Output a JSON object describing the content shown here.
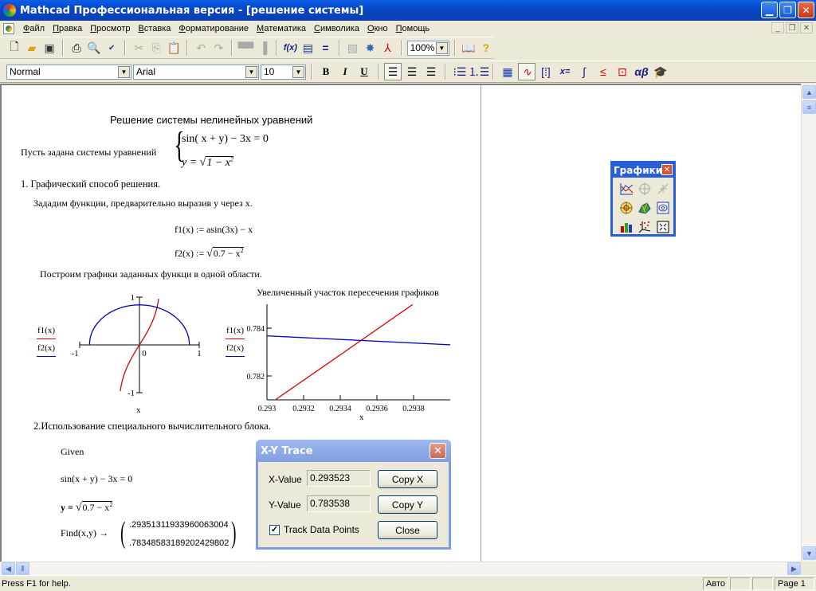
{
  "window": {
    "title": "Mathcad Профессиональная версия - [решение системы]",
    "minimize": "_",
    "restore": "❐",
    "close": "✕"
  },
  "menubar": {
    "items": [
      {
        "u": "Ф",
        "rest": "айл"
      },
      {
        "u": "П",
        "rest": "равка"
      },
      {
        "u": "П",
        "rest": "росмотр"
      },
      {
        "u": "В",
        "rest": "ставка"
      },
      {
        "u": "Ф",
        "rest": "орматирование"
      },
      {
        "u": "М",
        "rest": "атематика"
      },
      {
        "u": "С",
        "rest": "имволика"
      },
      {
        "u": "О",
        "rest": "кно"
      },
      {
        "u": "П",
        "rest": "омощь"
      }
    ]
  },
  "toolbar": {
    "zoom_value": "100%",
    "style_value": "Normal",
    "font_value": "Arial",
    "size_value": "10",
    "bold_label": "B",
    "italic_label": "I",
    "underline_label": "U"
  },
  "document": {
    "heading": "Решение системы нелинейных уравнений",
    "system_intro": "Пусть задана системы уравнений",
    "system_eq1": "sin( x + y) − 3x = 0",
    "system_eq2_lhs": "y = ",
    "system_eq2_rad": "1 − x",
    "section1": "1. Графический способ решения.",
    "section1_text": "Зададим функции, предварительно выразив у через х.",
    "f1_def": "f1(x) := asin(3x) − x",
    "f2_def_lhs": "f2(x) := ",
    "f2_def_rad": "0.7 − x",
    "plot_intro": "Построим графики заданных функци в одной области.",
    "section2": "2.Использование специального вычислительного блока.",
    "given": "Given",
    "eq1": "sin(x + y) − 3x = 0",
    "eq2_lhs": "y = ",
    "eq2_rad": "0.7 − x",
    "find": "Find(x,y) →",
    "find_x": ".29351311933960063004",
    "find_y": ".78348583189202429802",
    "sq": "2"
  },
  "chart_data": [
    {
      "type": "line",
      "title": "",
      "xlabel": "x",
      "ylabel": "",
      "xlim": [
        -1,
        1
      ],
      "ylim": [
        -1,
        1
      ],
      "x_ticks": [
        "-1",
        "0",
        "1"
      ],
      "y_ticks": [
        "1",
        "-1"
      ],
      "legend": [
        "f1(x)",
        "f2(x)"
      ],
      "legend_position": "left",
      "series": [
        {
          "name": "f1(x)",
          "expr": "asin(3x) - x",
          "domain": [
            -0.3333,
            0.3333
          ],
          "color": "#e00000"
        },
        {
          "name": "f2(x)",
          "expr": "sqrt(0.7 - x^2)",
          "domain": [
            -0.8367,
            0.8367
          ],
          "color": "#0000c0"
        }
      ]
    },
    {
      "type": "line",
      "title": "Увеличенный участок пересечения графиков",
      "xlabel": "x",
      "ylabel": "",
      "xlim": [
        0.293,
        0.294
      ],
      "ylim": [
        0.781,
        0.785
      ],
      "x_ticks": [
        "0.293",
        "0.2932",
        "0.2934",
        "0.2936",
        "0.2938"
      ],
      "y_ticks": [
        "0.784",
        "0.782"
      ],
      "legend": [
        "f1(x)",
        "f2(x)"
      ],
      "legend_position": "left",
      "series": [
        {
          "name": "f1(x)",
          "expr": "asin(3x) - x",
          "color": "#e00000"
        },
        {
          "name": "f2(x)",
          "expr": "sqrt(0.7 - x^2)",
          "color": "#0000c0"
        }
      ]
    }
  ],
  "trace_dialog": {
    "title": "X-Y Trace",
    "x_label": "X-Value",
    "y_label": "Y-Value",
    "x_value": "0.293523",
    "y_value": "0.783538",
    "copy_x": "Copy X",
    "copy_y": "Copy Y",
    "track_label": "Track Data Points",
    "track_checked": true,
    "close_label": "Close"
  },
  "graph_palette": {
    "title": "Графики",
    "tools": [
      "xy-plot",
      "polar-plot",
      "3d-surface",
      "polar-plot-2",
      "surface-plot",
      "contour-plot",
      "3d-bar-plot",
      "3d-scatter-plot",
      "vector-field-plot"
    ]
  },
  "statusbar": {
    "help": "Press F1 for help.",
    "mode": "Авто",
    "page": "Page 1"
  }
}
